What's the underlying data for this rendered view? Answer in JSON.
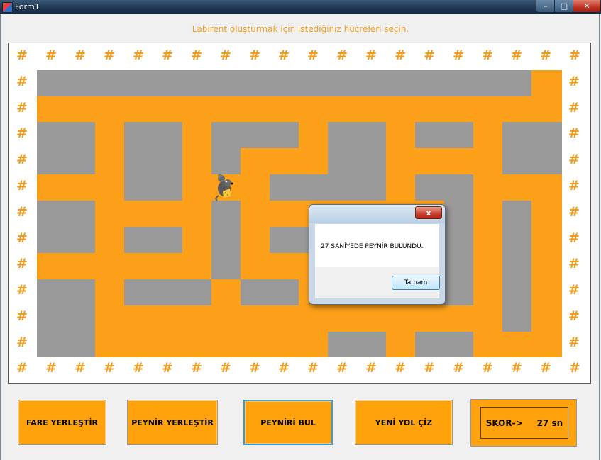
{
  "window": {
    "title": "Form1",
    "min_glyph": "–",
    "max_glyph": "□",
    "close_glyph": "✕"
  },
  "heading": "Labirent oluşturmak için istediğiniz hücreleri seçin.",
  "board": {
    "fence_glyph": "#",
    "fence_color": "#f19b1c",
    "path_color": "#fca019",
    "wall_color": "#d6d6d6",
    "mouse_icon": "mouse-icon",
    "wall_icon": "brick-wall-icon",
    "fence_icon": "fence-icon"
  },
  "buttons": {
    "place_mouse": "FARE YERLEŞTİR",
    "place_cheese": "PEYNİR YERLEŞTİR",
    "find_cheese": "PEYNİRİ BUL",
    "new_path": "YENİ YOL ÇİZ"
  },
  "score": {
    "label": "SKOR->",
    "value": "27 sn"
  },
  "dialog": {
    "close_glyph": "x",
    "message": "27 SANİYEDE PEYNİR BULUNDU.",
    "ok_label": "Tamam"
  },
  "colors": {
    "accent": "#ffa20c",
    "heading": "#f0a020",
    "title_bar": "#1d3550"
  }
}
